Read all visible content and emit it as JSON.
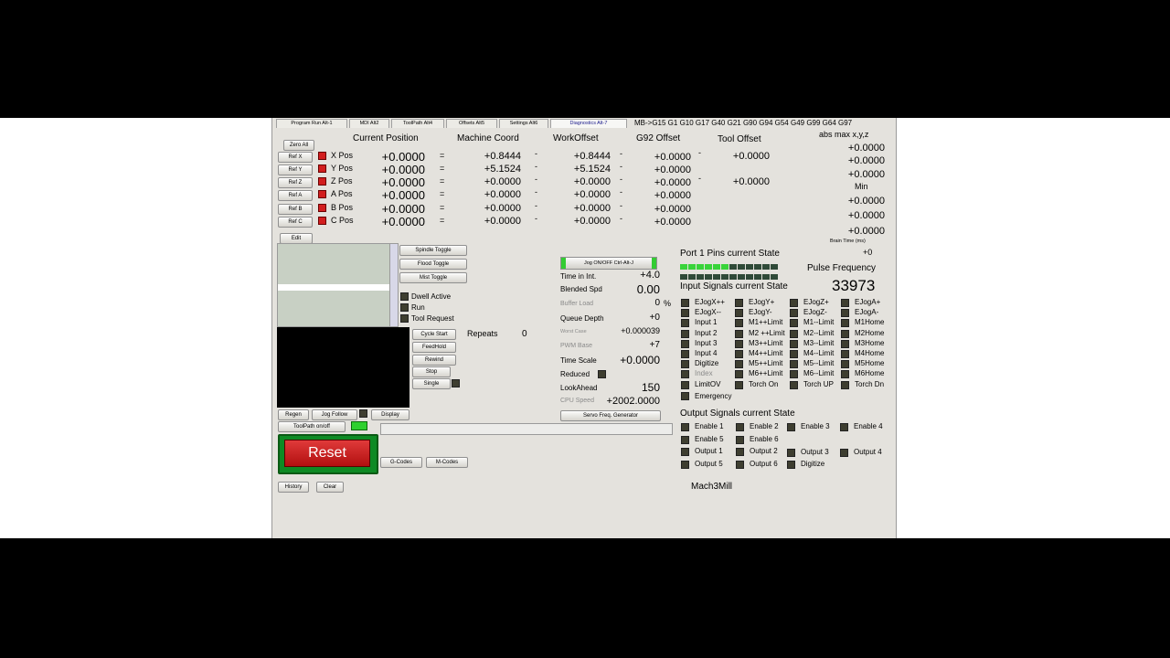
{
  "tabs": [
    {
      "label": "Program Run Alt-1",
      "active": false
    },
    {
      "label": "MDI Alt2",
      "active": false
    },
    {
      "label": "ToolPath Alt4",
      "active": false
    },
    {
      "label": "Offsets Alt5",
      "active": false
    },
    {
      "label": "Settings Alt6",
      "active": false
    },
    {
      "label": "Diagnostics Alt-7",
      "active": true
    }
  ],
  "gcode_status": "MB->G15  G1 G10 G17 G40 G21 G90 G94 G54 G49 G99 G64 G97",
  "headers": {
    "current_position": "Current Position",
    "machine_coord": "Machine Coord",
    "work_offset": "WorkOffset",
    "g92_offset": "G92 Offset",
    "tool_offset": "Tool Offset",
    "abs_max": "abs max x,y,z",
    "min": "Min",
    "brain_time": "Brain Time (ms)",
    "brain_time_value": "+0"
  },
  "zero_all_label": "Zero All",
  "axes": [
    {
      "ref": "Ref X",
      "label": "X Pos",
      "pos": "+0.0000",
      "eq": "=",
      "machine": "+0.8444",
      "minus1": "-",
      "work": "+0.8444",
      "minus2": "-",
      "g92": "+0.0000",
      "minus3": "-",
      "tool": "+0.0000"
    },
    {
      "ref": "Ref Y",
      "label": "Y Pos",
      "pos": "+0.0000",
      "eq": "=",
      "machine": "+5.1524",
      "minus1": "-",
      "work": "+5.1524",
      "minus2": "-",
      "g92": "+0.0000",
      "minus3": "",
      "tool": ""
    },
    {
      "ref": "Ref Z",
      "label": "Z Pos",
      "pos": "+0.0000",
      "eq": "=",
      "machine": "+0.0000",
      "minus1": "-",
      "work": "+0.0000",
      "minus2": "-",
      "g92": "+0.0000",
      "minus3": "-",
      "tool": "+0.0000"
    },
    {
      "ref": "Ref A",
      "label": "A Pos",
      "pos": "+0.0000",
      "eq": "=",
      "machine": "+0.0000",
      "minus1": "-",
      "work": "+0.0000",
      "minus2": "-",
      "g92": "+0.0000",
      "minus3": "",
      "tool": ""
    },
    {
      "ref": "Ref B",
      "label": "B Pos",
      "pos": "+0.0000",
      "eq": "=",
      "machine": "+0.0000",
      "minus1": "-",
      "work": "+0.0000",
      "minus2": "-",
      "g92": "+0.0000",
      "minus3": "",
      "tool": ""
    },
    {
      "ref": "Ref C",
      "label": "C Pos",
      "pos": "+0.0000",
      "eq": "=",
      "machine": "+0.0000",
      "minus1": "-",
      "work": "+0.0000",
      "minus2": "-",
      "g92": "+0.0000",
      "minus3": "",
      "tool": ""
    }
  ],
  "abs_max_values": [
    "+0.0000",
    "+0.0000",
    "+0.0000"
  ],
  "min_values": [
    "+0.0000",
    "+0.0000",
    "+0.0000"
  ],
  "edit_label": "Edit",
  "toggles": [
    "Spindle Toggle",
    "Flood Toggle",
    "Mist Toggle"
  ],
  "status_checks": [
    "Dwell Active",
    "Run",
    "Tool Request"
  ],
  "controls": [
    "Cycle Start",
    "FeedHold",
    "Rewind",
    "Stop",
    "Single"
  ],
  "repeats": {
    "label": "Repeats",
    "value": "0"
  },
  "regen_label": "Regen",
  "jog_follow_label": "Jog Follow",
  "display_label": "Display",
  "toolpath_onoff_label": "ToolPath on/off",
  "reset_label": "Reset",
  "gcodes_label": "G-Codes",
  "mcodes_label": "M-Codes",
  "history_label": "History",
  "clear_label": "Clear",
  "jog_onoff_label": "Jog ON/OFF Ctrl-Alt-J",
  "stats": {
    "time_in_int": {
      "label": "Time in Int.",
      "value": "+4.0"
    },
    "blended_spd": {
      "label": "Blended Spd",
      "value": "0.00"
    },
    "buffer_load": {
      "label": "Buffer Load",
      "value": "0",
      "unit": "%"
    },
    "queue_depth": {
      "label": "Queue Depth",
      "value": "+0"
    },
    "worst_case": {
      "label": "Worst Case",
      "value": "+0.000039"
    },
    "pwm_base": {
      "label": "PWM Base",
      "value": "+7"
    },
    "time_scale": {
      "label": "Time Scale",
      "value": "+0.0000"
    },
    "reduced": {
      "label": "Reduced"
    },
    "lookahead": {
      "label": "LookAhead",
      "value": "150"
    },
    "cpu_speed": {
      "label": "CPU Speed",
      "value": "+2002.0000"
    }
  },
  "servo_freq_label": "Servo Freq. Generator",
  "port_pins_title": "Port 1 Pins current State",
  "pins_row1": [
    true,
    true,
    true,
    true,
    true,
    true,
    false,
    false,
    false,
    false,
    false,
    false
  ],
  "pins_row2": [
    false,
    false,
    false,
    false,
    false,
    false,
    false,
    false,
    false,
    false,
    false,
    false
  ],
  "pulse_frequency": {
    "label": "Pulse Frequency",
    "value": "33973"
  },
  "input_title": "Input Signals current State",
  "input_signals": [
    [
      "EJogX++",
      "EJogY+",
      "EJogZ+",
      "EJogA+"
    ],
    [
      "EJogX--",
      "EJogY-",
      "EJogZ-",
      "EJogA-"
    ],
    [
      "Input 1",
      "M1++Limit",
      "M1--Limit",
      "M1Home"
    ],
    [
      "Input 2",
      "M2 ++Limit",
      "M2--Limit",
      "M2Home"
    ],
    [
      "Input 3",
      "M3++Limit",
      "M3--Limit",
      "M3Home"
    ],
    [
      "Input 4",
      "M4++Limit",
      "M4--Limit",
      "M4Home"
    ],
    [
      "Digitize",
      "M5++Limit",
      "M5--Limit",
      "M5Home"
    ],
    [
      "Index",
      "M6++Limit",
      "M6--Limit",
      "M6Home"
    ],
    [
      "LimitOV",
      "Torch On",
      "Torch UP",
      "Torch Dn"
    ]
  ],
  "emergency_label": "Emergency",
  "output_title": "Output Signals current State",
  "output_signals": [
    [
      "Enable 1",
      "Enable 2",
      "Enable 3",
      "Enable 4"
    ],
    [
      "Enable 5",
      "Enable 6",
      "",
      ""
    ],
    [
      "Output 1",
      "Output 2",
      "Output 3",
      "Output 4"
    ],
    [
      "Output 5",
      "Output 6",
      "Digitize",
      ""
    ]
  ],
  "profile_label": "Mach3Mill"
}
